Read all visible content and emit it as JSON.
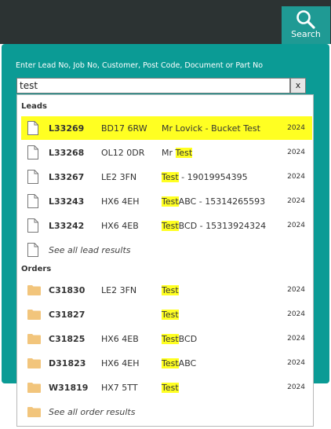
{
  "header": {
    "search_button_label": "Search"
  },
  "search": {
    "prompt": "Enter Lead No, Job No, Customer, Post Code, Document or Part No",
    "value": "test",
    "clear_label": "x"
  },
  "results": {
    "leads_heading": "Leads",
    "leads": [
      {
        "ref": "L33269",
        "postcode": "BD17 6RW",
        "pre": "Mr Lovick - Bucket Test",
        "match": "",
        "post": "",
        "year": "2024",
        "highlighted": true
      },
      {
        "ref": "L33268",
        "postcode": "OL12 0DR",
        "pre": "Mr ",
        "match": "Test",
        "post": "",
        "year": "2024"
      },
      {
        "ref": "L33267",
        "postcode": "LE2 3FN",
        "pre": "",
        "match": "Test",
        "post": " - 19019954395",
        "year": "2024"
      },
      {
        "ref": "L33243",
        "postcode": "HX6 4EH",
        "pre": "",
        "match": "Test",
        "post": "ABC - 15314265593",
        "year": "2024"
      },
      {
        "ref": "L33242",
        "postcode": "HX6 4EB",
        "pre": "",
        "match": "Test",
        "post": "BCD - 15313924324",
        "year": "2024"
      }
    ],
    "see_all_leads": "See all lead results",
    "orders_heading": "Orders",
    "orders": [
      {
        "ref": "C31830",
        "postcode": "LE2 3FN",
        "pre": "",
        "match": "Test",
        "post": "",
        "year": "2024"
      },
      {
        "ref": "C31827",
        "postcode": "",
        "pre": "",
        "match": "Test",
        "post": "",
        "year": "2024"
      },
      {
        "ref": "C31825",
        "postcode": "HX6 4EB",
        "pre": "",
        "match": "Test",
        "post": "BCD",
        "year": "2024"
      },
      {
        "ref": "D31823",
        "postcode": "HX6 4EH",
        "pre": "",
        "match": "Test",
        "post": "ABC",
        "year": "2024"
      },
      {
        "ref": "W31819",
        "postcode": "HX7 5TT",
        "pre": "",
        "match": "Test",
        "post": "",
        "year": "2024"
      }
    ],
    "see_all_orders": "See all order results"
  },
  "colors": {
    "accent": "#0b9b95",
    "search_button": "#1f9a94",
    "topbar": "#2c3333",
    "highlight": "#ffff22",
    "folder": "#f2c57c"
  },
  "icons": {
    "lead": "document-icon",
    "order": "folder-icon",
    "search": "magnifier-icon"
  }
}
